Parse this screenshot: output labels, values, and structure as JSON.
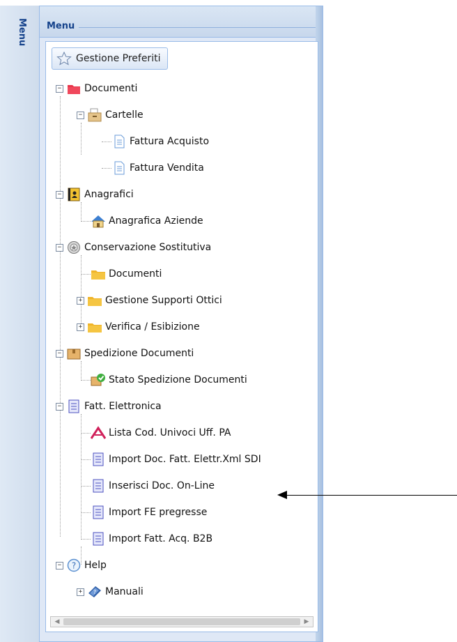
{
  "side_strip": {
    "title": "Menu"
  },
  "panel": {
    "title": "Menu"
  },
  "favorites_button": {
    "label": "Gestione Preferiti"
  },
  "tree": {
    "documenti": {
      "label": "Documenti",
      "toggle": "−"
    },
    "cartelle": {
      "label": "Cartelle",
      "toggle": "−"
    },
    "fattura_acquisto": {
      "label": "Fattura Acquisto"
    },
    "fattura_vendita": {
      "label": "Fattura Vendita"
    },
    "anagrafici": {
      "label": "Anagrafici",
      "toggle": "−"
    },
    "anagrafica_aziende": {
      "label": "Anagrafica Aziende"
    },
    "conservazione": {
      "label": "Conservazione Sostitutiva",
      "toggle": "−"
    },
    "cons_documenti": {
      "label": "Documenti"
    },
    "supporti_ottici": {
      "label": "Gestione Supporti Ottici",
      "toggle": "+"
    },
    "verifica": {
      "label": "Verifica / Esibizione",
      "toggle": "+"
    },
    "spedizione": {
      "label": "Spedizione Documenti",
      "toggle": "−"
    },
    "stato_spedizione": {
      "label": "Stato Spedizione Documenti"
    },
    "fatt_elettronica": {
      "label": "Fatt. Elettronica",
      "toggle": "−"
    },
    "lista_cod": {
      "label": "Lista Cod. Univoci Uff. PA"
    },
    "import_sdi": {
      "label": "Import Doc. Fatt. Elettr.Xml SDI"
    },
    "inserisci": {
      "label": "Inserisci Doc. On-Line"
    },
    "import_fe": {
      "label": "Import FE pregresse"
    },
    "import_b2b": {
      "label": "Import Fatt. Acq. B2B"
    },
    "help": {
      "label": "Help",
      "toggle": "−"
    },
    "manuali": {
      "label": "Manuali",
      "toggle": "+"
    }
  },
  "scrollbar": {
    "left_arrow": "◀",
    "right_arrow": "▶"
  },
  "colors": {
    "accent": "#15428b",
    "panel_border": "#99bbe8",
    "folder_yellow": "#f5c542",
    "folder_red": "#e8364b"
  }
}
